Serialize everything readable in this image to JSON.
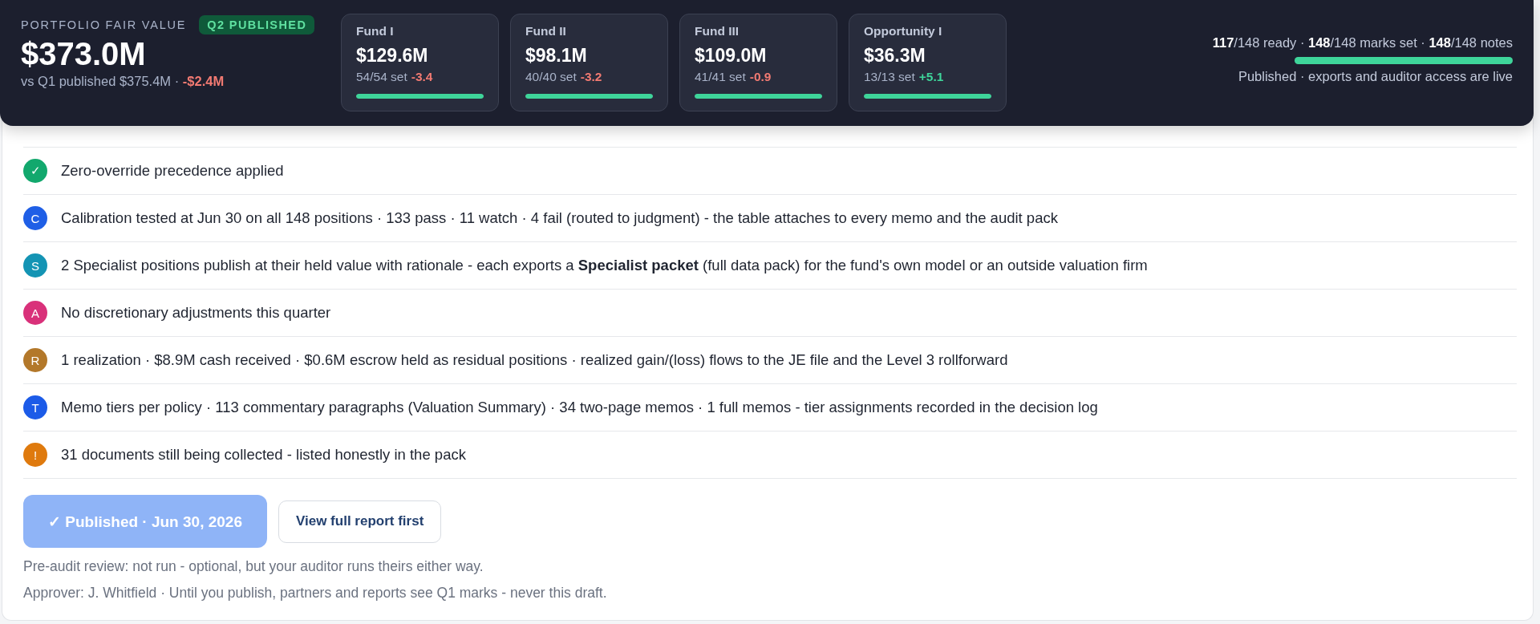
{
  "header": {
    "label": "PORTFOLIO FAIR VALUE",
    "badge": "Q2 PUBLISHED",
    "total": "$373.0M",
    "comparison": "vs Q1 published $375.4M · ",
    "delta": "-$2.4M",
    "funds": [
      {
        "name": "Fund I",
        "value": "$129.6M",
        "count": "54/54 set",
        "delta": "-3.4",
        "color": "#f27a72",
        "level": 1
      },
      {
        "name": "Fund II",
        "value": "$98.1M",
        "count": "40/40 set",
        "delta": "-3.2",
        "color": "#f27a72",
        "level": 1
      },
      {
        "name": "Fund III",
        "value": "$109.0M",
        "count": "41/41 set",
        "delta": "-0.9",
        "color": "#f27a72",
        "level": 1
      },
      {
        "name": "Opportunity I",
        "value": "$36.3M",
        "count": "13/13 set",
        "delta": "+5.1",
        "color": "#3ed59a",
        "level": 1
      }
    ],
    "summary": "**117**/148 ready · **148**/148 marks set · **148**/148 notes",
    "level": 1,
    "status": "Published · exports and auditor access are live"
  },
  "checklist": [
    {
      "badge": "✓",
      "color": "#12a86d",
      "text": "Zero-override precedence applied"
    },
    {
      "badge": "C",
      "color": "#1f5fe6",
      "text": "Calibration tested at Jun 30 on all 148 positions · 133 pass · 11 watch · 4 fail (routed to judgment) - the table attaches to every memo and the audit pack"
    },
    {
      "badge": "S",
      "color": "#1494b4",
      "text": "2 Specialist positions publish at their held value with rationale - each exports a **Specialist packet** (full data pack) for the fund's own model or an outside valuation firm"
    },
    {
      "badge": "A",
      "color": "#d9317a",
      "text": "No discretionary adjustments this quarter"
    },
    {
      "badge": "R",
      "color": "#b3782a",
      "text": "1 realization · $8.9M cash received · $0.6M escrow held as residual positions · realized gain/(loss) flows to the JE file and the Level 3 rollforward"
    },
    {
      "badge": "T",
      "color": "#1c5be8",
      "text": "Memo tiers per policy · 113 commentary paragraphs (Valuation Summary) · 34 two-page memos · 1 full memos - tier assignments recorded in the decision log"
    },
    {
      "badge": "!",
      "color": "#df7a0e",
      "text": "31 documents still being collected - listed honestly in the pack"
    }
  ],
  "actions": {
    "publish": {
      "label": "✓ Published · Jun 30, 2026",
      "disabled": true
    },
    "secondary": "View full report first"
  },
  "notes": [
    "Pre-audit review: not run - optional, but your auditor runs theirs either way.",
    "Approver: J. Whitfield · Until you publish, partners and reports see Q1 marks - never this draft."
  ]
}
